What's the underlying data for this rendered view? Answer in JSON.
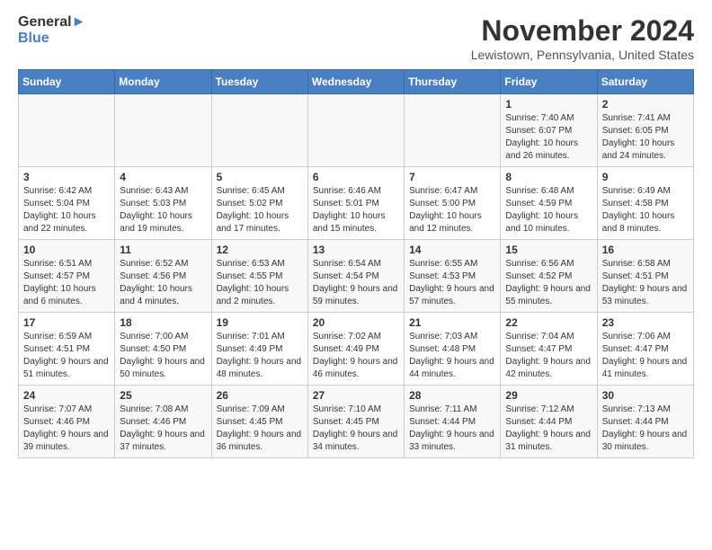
{
  "logo": {
    "line1": "General",
    "line2": "Blue"
  },
  "title": "November 2024",
  "subtitle": "Lewistown, Pennsylvania, United States",
  "header": {
    "accent_color": "#4a7fc1"
  },
  "days_of_week": [
    "Sunday",
    "Monday",
    "Tuesday",
    "Wednesday",
    "Thursday",
    "Friday",
    "Saturday"
  ],
  "weeks": [
    [
      {
        "day": "",
        "content": ""
      },
      {
        "day": "",
        "content": ""
      },
      {
        "day": "",
        "content": ""
      },
      {
        "day": "",
        "content": ""
      },
      {
        "day": "",
        "content": ""
      },
      {
        "day": "1",
        "content": "Sunrise: 7:40 AM\nSunset: 6:07 PM\nDaylight: 10 hours and 26 minutes."
      },
      {
        "day": "2",
        "content": "Sunrise: 7:41 AM\nSunset: 6:05 PM\nDaylight: 10 hours and 24 minutes."
      }
    ],
    [
      {
        "day": "3",
        "content": "Sunrise: 6:42 AM\nSunset: 5:04 PM\nDaylight: 10 hours and 22 minutes."
      },
      {
        "day": "4",
        "content": "Sunrise: 6:43 AM\nSunset: 5:03 PM\nDaylight: 10 hours and 19 minutes."
      },
      {
        "day": "5",
        "content": "Sunrise: 6:45 AM\nSunset: 5:02 PM\nDaylight: 10 hours and 17 minutes."
      },
      {
        "day": "6",
        "content": "Sunrise: 6:46 AM\nSunset: 5:01 PM\nDaylight: 10 hours and 15 minutes."
      },
      {
        "day": "7",
        "content": "Sunrise: 6:47 AM\nSunset: 5:00 PM\nDaylight: 10 hours and 12 minutes."
      },
      {
        "day": "8",
        "content": "Sunrise: 6:48 AM\nSunset: 4:59 PM\nDaylight: 10 hours and 10 minutes."
      },
      {
        "day": "9",
        "content": "Sunrise: 6:49 AM\nSunset: 4:58 PM\nDaylight: 10 hours and 8 minutes."
      }
    ],
    [
      {
        "day": "10",
        "content": "Sunrise: 6:51 AM\nSunset: 4:57 PM\nDaylight: 10 hours and 6 minutes."
      },
      {
        "day": "11",
        "content": "Sunrise: 6:52 AM\nSunset: 4:56 PM\nDaylight: 10 hours and 4 minutes."
      },
      {
        "day": "12",
        "content": "Sunrise: 6:53 AM\nSunset: 4:55 PM\nDaylight: 10 hours and 2 minutes."
      },
      {
        "day": "13",
        "content": "Sunrise: 6:54 AM\nSunset: 4:54 PM\nDaylight: 9 hours and 59 minutes."
      },
      {
        "day": "14",
        "content": "Sunrise: 6:55 AM\nSunset: 4:53 PM\nDaylight: 9 hours and 57 minutes."
      },
      {
        "day": "15",
        "content": "Sunrise: 6:56 AM\nSunset: 4:52 PM\nDaylight: 9 hours and 55 minutes."
      },
      {
        "day": "16",
        "content": "Sunrise: 6:58 AM\nSunset: 4:51 PM\nDaylight: 9 hours and 53 minutes."
      }
    ],
    [
      {
        "day": "17",
        "content": "Sunrise: 6:59 AM\nSunset: 4:51 PM\nDaylight: 9 hours and 51 minutes."
      },
      {
        "day": "18",
        "content": "Sunrise: 7:00 AM\nSunset: 4:50 PM\nDaylight: 9 hours and 50 minutes."
      },
      {
        "day": "19",
        "content": "Sunrise: 7:01 AM\nSunset: 4:49 PM\nDaylight: 9 hours and 48 minutes."
      },
      {
        "day": "20",
        "content": "Sunrise: 7:02 AM\nSunset: 4:49 PM\nDaylight: 9 hours and 46 minutes."
      },
      {
        "day": "21",
        "content": "Sunrise: 7:03 AM\nSunset: 4:48 PM\nDaylight: 9 hours and 44 minutes."
      },
      {
        "day": "22",
        "content": "Sunrise: 7:04 AM\nSunset: 4:47 PM\nDaylight: 9 hours and 42 minutes."
      },
      {
        "day": "23",
        "content": "Sunrise: 7:06 AM\nSunset: 4:47 PM\nDaylight: 9 hours and 41 minutes."
      }
    ],
    [
      {
        "day": "24",
        "content": "Sunrise: 7:07 AM\nSunset: 4:46 PM\nDaylight: 9 hours and 39 minutes."
      },
      {
        "day": "25",
        "content": "Sunrise: 7:08 AM\nSunset: 4:46 PM\nDaylight: 9 hours and 37 minutes."
      },
      {
        "day": "26",
        "content": "Sunrise: 7:09 AM\nSunset: 4:45 PM\nDaylight: 9 hours and 36 minutes."
      },
      {
        "day": "27",
        "content": "Sunrise: 7:10 AM\nSunset: 4:45 PM\nDaylight: 9 hours and 34 minutes."
      },
      {
        "day": "28",
        "content": "Sunrise: 7:11 AM\nSunset: 4:44 PM\nDaylight: 9 hours and 33 minutes."
      },
      {
        "day": "29",
        "content": "Sunrise: 7:12 AM\nSunset: 4:44 PM\nDaylight: 9 hours and 31 minutes."
      },
      {
        "day": "30",
        "content": "Sunrise: 7:13 AM\nSunset: 4:44 PM\nDaylight: 9 hours and 30 minutes."
      }
    ]
  ]
}
